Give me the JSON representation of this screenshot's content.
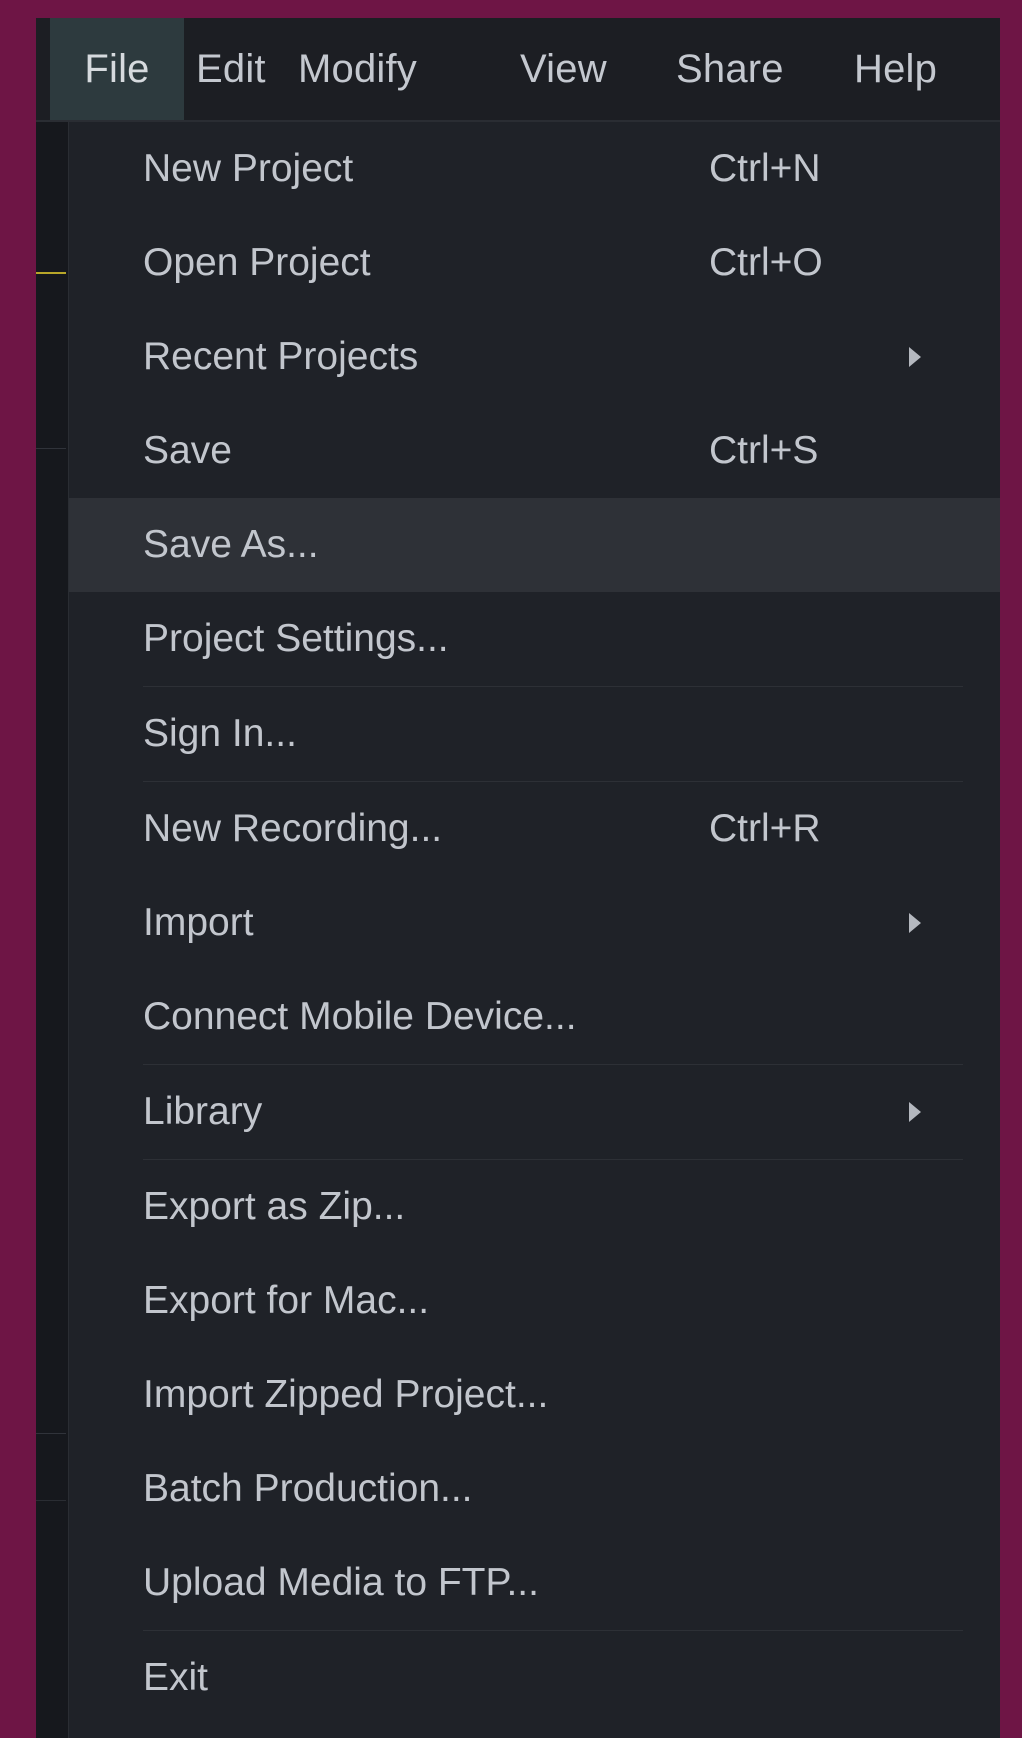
{
  "menubar": {
    "items": [
      {
        "label": "File",
        "active": true
      },
      {
        "label": "Edit"
      },
      {
        "label": "Modify"
      },
      {
        "label": "View"
      },
      {
        "label": "Share"
      },
      {
        "label": "Help"
      }
    ]
  },
  "file_menu": {
    "items": [
      {
        "label": "New Project",
        "shortcut": "Ctrl+N"
      },
      {
        "label": "Open Project",
        "shortcut": "Ctrl+O"
      },
      {
        "label": "Recent Projects",
        "submenu": true
      },
      {
        "label": "Save",
        "shortcut": "Ctrl+S"
      },
      {
        "label": "Save As...",
        "highlighted": true
      },
      {
        "label": "Project Settings..."
      },
      {
        "label": "Sign In..."
      },
      {
        "label": "New Recording...",
        "shortcut": "Ctrl+R"
      },
      {
        "label": "Import",
        "submenu": true
      },
      {
        "label": "Connect Mobile Device..."
      },
      {
        "label": "Library",
        "submenu": true
      },
      {
        "label": "Export as Zip..."
      },
      {
        "label": "Export for Mac..."
      },
      {
        "label": "Import Zipped Project..."
      },
      {
        "label": "Batch Production..."
      },
      {
        "label": "Upload Media to FTP..."
      },
      {
        "label": "Exit"
      }
    ]
  },
  "colors": {
    "page_background": "#6e1545",
    "menu_background": "#1f2228",
    "menubar_background": "#1c1e23",
    "active_menubar_item": "#2d3a3e",
    "highlighted_item": "#2e3137",
    "text": "#c2c6cd"
  },
  "icons": {
    "submenu_arrow": "chevron-right-icon"
  }
}
